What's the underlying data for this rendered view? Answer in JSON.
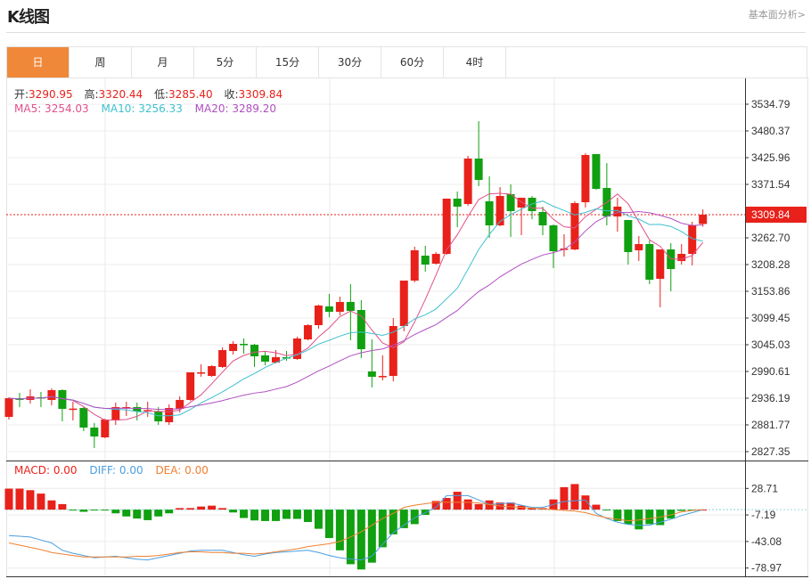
{
  "header": {
    "title": "K线图",
    "link": "基本面分析>"
  },
  "tabs": [
    {
      "label": "日",
      "active": true
    },
    {
      "label": "周"
    },
    {
      "label": "月"
    },
    {
      "label": "5分"
    },
    {
      "label": "15分"
    },
    {
      "label": "30分"
    },
    {
      "label": "60分"
    },
    {
      "label": "4时"
    }
  ],
  "legend": {
    "open_label": "开:",
    "open": "3290.95",
    "high_label": "高:",
    "high": "3320.44",
    "low_label": "低:",
    "low": "3285.40",
    "close_label": "收:",
    "close": "3309.84",
    "ma5": "MA5: 3254.03",
    "ma10": "MA10: 3256.33",
    "ma20": "MA20: 3289.20",
    "macd": "MACD: 0.00",
    "diff": "DIFF: 0.00",
    "dea": "DEA: 0.00"
  },
  "colors": {
    "up": "#e8211a",
    "down": "#10a010",
    "ma5": "#e0508a",
    "ma10": "#40c0d0",
    "ma20": "#b050c0",
    "diff": "#4a9ee0",
    "dea": "#f08030",
    "active_tab": "#f0883a"
  },
  "chart_data": [
    {
      "type": "candlestick",
      "y_ticks": [
        "3534.79",
        "3480.37",
        "3425.96",
        "3371.54",
        "3309.84",
        "3262.70",
        "3208.28",
        "3153.86",
        "3099.45",
        "3045.03",
        "2990.61",
        "2936.19",
        "2881.77",
        "2827.35"
      ],
      "ylim": [
        2827.35,
        3534.79
      ],
      "last_price": "3309.84",
      "grid": true,
      "candles_ohlc": [
        [
          2898.1,
          2936.2,
          2938.0,
          2892.7
        ],
        [
          2936.2,
          2932.6,
          2947.1,
          2918.0
        ],
        [
          2932.6,
          2939.8,
          2954.3,
          2925.3
        ],
        [
          2938.0,
          2936.2,
          2948.9,
          2918.0
        ],
        [
          2932.6,
          2952.5,
          2956.1,
          2921.7
        ],
        [
          2952.5,
          2914.4,
          2954.3,
          2889.0
        ],
        [
          2914.4,
          2915.0,
          2928.9,
          2890.8
        ],
        [
          2916.2,
          2876.3,
          2918.0,
          2869.1
        ],
        [
          2876.3,
          2858.2,
          2885.4,
          2834.6
        ],
        [
          2856.4,
          2892.7,
          2894.5,
          2854.6
        ],
        [
          2890.8,
          2918.0,
          2927.1,
          2881.8
        ],
        [
          2916.2,
          2918.0,
          2928.9,
          2899.9
        ],
        [
          2918.0,
          2909.0,
          2927.1,
          2890.8
        ],
        [
          2910.8,
          2912.0,
          2928.9,
          2898.1
        ],
        [
          2909.0,
          2889.0,
          2918.0,
          2881.8
        ],
        [
          2887.2,
          2916.2,
          2923.5,
          2881.8
        ],
        [
          2914.4,
          2932.6,
          2939.8,
          2907.2
        ],
        [
          2932.6,
          2988.8,
          2988.8,
          2930.7
        ],
        [
          2987.0,
          2988.8,
          3005.1,
          2979.7
        ],
        [
          2981.5,
          3001.5,
          3003.3,
          2979.7
        ],
        [
          2999.7,
          3034.1,
          3039.6,
          2997.9
        ],
        [
          3032.3,
          3046.8,
          3052.3,
          3025.1
        ],
        [
          3046.8,
          3045.0,
          3057.7,
          3026.9
        ],
        [
          3045.0,
          3021.4,
          3046.8,
          2999.7
        ],
        [
          3023.3,
          3010.6,
          3030.5,
          3003.3
        ],
        [
          3008.8,
          3019.6,
          3034.1,
          3006.9
        ],
        [
          3019.6,
          3017.8,
          3032.3,
          3012.4
        ],
        [
          3016.0,
          3057.7,
          3061.4,
          3014.2
        ],
        [
          3055.9,
          3084.9,
          3086.7,
          3054.1
        ],
        [
          3084.9,
          3124.8,
          3126.6,
          3077.7
        ],
        [
          3123.0,
          3112.1,
          3148.4,
          3101.3
        ],
        [
          3112.1,
          3132.1,
          3143.0,
          3104.9
        ],
        [
          3132.1,
          3113.9,
          3168.4,
          3054.1
        ],
        [
          3115.8,
          3035.9,
          3135.7,
          3017.8
        ],
        [
          2990.6,
          2979.7,
          3055.9,
          2958.0
        ],
        [
          2979.7,
          2981.5,
          3023.3,
          2972.5
        ],
        [
          2981.5,
          3083.1,
          3099.4,
          2970.6
        ],
        [
          3083.1,
          3175.6,
          3175.6,
          3072.2
        ],
        [
          3175.6,
          3237.3,
          3244.6,
          3172.0
        ],
        [
          3226.4,
          3208.3,
          3246.4,
          3193.8
        ],
        [
          3210.1,
          3230.0,
          3233.7,
          3208.3
        ],
        [
          3230.0,
          3342.5,
          3342.5,
          3228.2
        ],
        [
          3342.5,
          3326.2,
          3357.0,
          3284.5
        ],
        [
          3331.6,
          3424.1,
          3429.6,
          3328.0
        ],
        [
          3424.1,
          3380.6,
          3500.3,
          3367.9
        ],
        [
          3337.1,
          3288.1,
          3387.8,
          3262.7
        ],
        [
          3288.1,
          3347.9,
          3366.1,
          3286.3
        ],
        [
          3351.6,
          3317.1,
          3371.5,
          3264.5
        ],
        [
          3324.4,
          3344.3,
          3344.3,
          3268.1
        ],
        [
          3344.3,
          3317.1,
          3347.9,
          3300.8
        ],
        [
          3315.3,
          3288.1,
          3326.2,
          3268.1
        ],
        [
          3288.1,
          3235.5,
          3289.9,
          3201.0
        ],
        [
          3239.1,
          3240.9,
          3270.0,
          3224.6
        ],
        [
          3239.1,
          3333.4,
          3337.1,
          3237.3
        ],
        [
          3335.2,
          3431.4,
          3435.0,
          3324.4
        ],
        [
          3433.2,
          3362.4,
          3433.2,
          3360.6
        ],
        [
          3364.3,
          3306.2,
          3415.0,
          3288.1
        ],
        [
          3306.2,
          3326.2,
          3344.3,
          3275.4
        ],
        [
          3299.0,
          3233.7,
          3299.0,
          3208.3
        ],
        [
          3237.3,
          3250.0,
          3266.3,
          3215.5
        ],
        [
          3250.0,
          3177.4,
          3257.3,
          3168.4
        ],
        [
          3179.3,
          3239.1,
          3239.1,
          3121.2
        ],
        [
          3239.1,
          3199.2,
          3251.8,
          3153.9
        ],
        [
          3215.5,
          3230.0,
          3250.0,
          3208.3
        ],
        [
          3230.0,
          3288.1,
          3295.4,
          3206.5
        ],
        [
          3290.95,
          3309.84,
          3320.44,
          3285.4
        ]
      ],
      "series": [
        {
          "name": "MA5",
          "period": 5
        },
        {
          "name": "MA10",
          "period": 10
        },
        {
          "name": "MA20",
          "period": 20
        }
      ]
    },
    {
      "type": "bar+line",
      "y_ticks": [
        "28.71",
        "-7.19",
        "-43.08",
        "-78.97"
      ],
      "ylim": [
        -78.97,
        28.71
      ],
      "macd": [
        28.4,
        28.4,
        26.3,
        21.7,
        12.5,
        7.5,
        -0.5,
        -2.9,
        -0.5,
        -0.5,
        -5,
        -9.2,
        -12,
        -14.2,
        -9.2,
        -5,
        2.1,
        2.1,
        4.2,
        5.4,
        2.1,
        -3.8,
        -11.3,
        -14.6,
        -15.4,
        -15.4,
        -12.5,
        -12.5,
        -16.7,
        -25.9,
        -38.4,
        -55,
        -73.8,
        -80.9,
        -71.7,
        -50.9,
        -33.4,
        -25,
        -19.6,
        -7.1,
        11.7,
        15.8,
        24.2,
        13.8,
        7.5,
        12.5,
        9.6,
        9.6,
        5.4,
        2.1,
        2.1,
        13.8,
        30.4,
        34.6,
        19.2,
        6.7,
        -0.5,
        -15.4,
        -19.6,
        -26.7,
        -19.6,
        -20.9,
        -12.1,
        -1.7,
        -0.5,
        0
      ],
      "diff": [
        -35,
        -36,
        -37,
        -41,
        -45,
        -55,
        -59,
        -62,
        -65,
        -64,
        -63,
        -65,
        -67,
        -68,
        -65,
        -62,
        -59,
        -56,
        -55,
        -55,
        -55,
        -58,
        -61,
        -63,
        -60,
        -58,
        -57,
        -56,
        -55,
        -58,
        -62,
        -65,
        -67,
        -68,
        -63,
        -47,
        -31,
        -21,
        -11,
        -4,
        3,
        19,
        19,
        19,
        13,
        7,
        8,
        9,
        6,
        3,
        3,
        7,
        11,
        12,
        13,
        -5,
        -12,
        -17,
        -20,
        -21,
        -21,
        -17,
        -13,
        -8,
        -4,
        0
      ],
      "dea": [
        -45,
        -48,
        -51,
        -54,
        -58,
        -60,
        -62,
        -64,
        -64,
        -64,
        -64,
        -64,
        -63,
        -63,
        -62,
        -60,
        -58,
        -57,
        -57,
        -58,
        -58,
        -59,
        -59,
        -60,
        -59,
        -57,
        -55,
        -53,
        -50,
        -48,
        -46,
        -43,
        -37,
        -30,
        -21,
        -12,
        -5,
        3,
        6,
        8,
        10,
        10,
        10,
        10,
        9,
        7,
        5,
        4,
        3,
        2,
        1,
        0,
        -1,
        -2,
        -4,
        -8,
        -11,
        -13,
        -15,
        -14,
        -12,
        -10,
        -7,
        -3,
        -1,
        0
      ]
    }
  ]
}
